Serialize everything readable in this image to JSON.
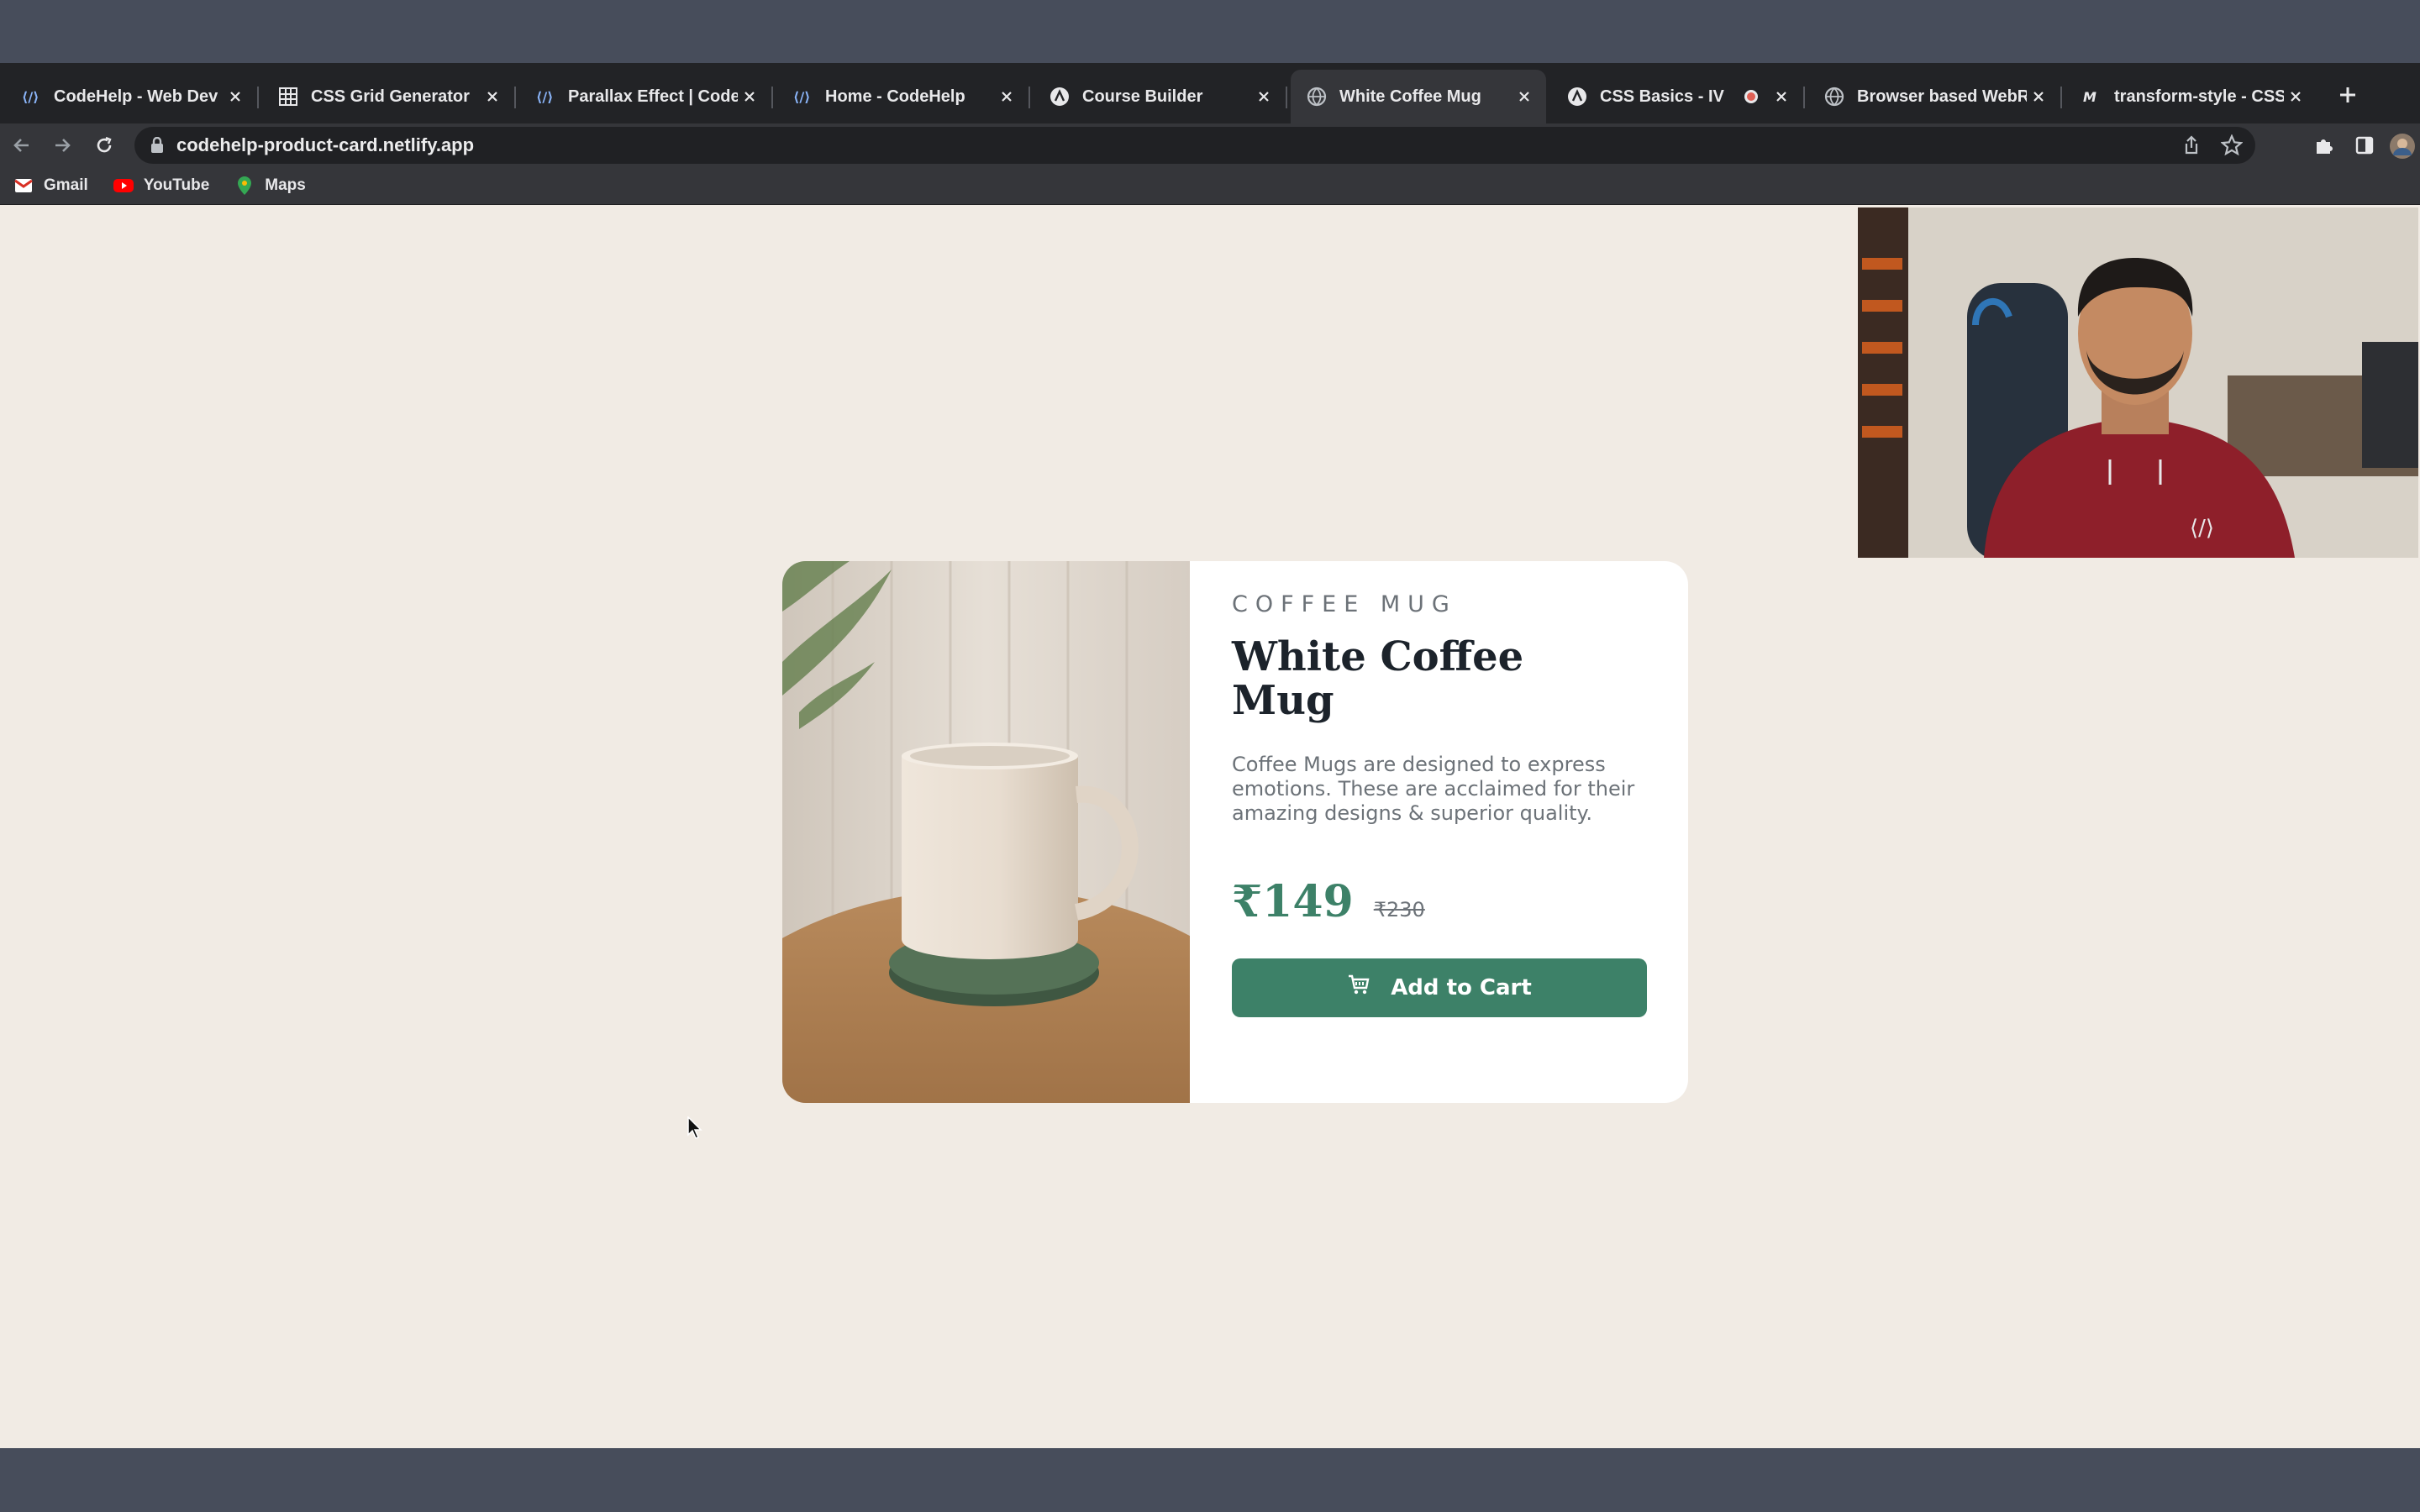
{
  "browser": {
    "tabs": [
      {
        "label": "CodeHelp - Web Dev",
        "icon": "codehelp-icon",
        "active": false
      },
      {
        "label": "CSS Grid Generator",
        "icon": "grid-icon",
        "active": false
      },
      {
        "label": "Parallax Effect | CodeHe",
        "icon": "codehelp-icon",
        "active": false
      },
      {
        "label": "Home - CodeHelp",
        "icon": "codehelp-icon",
        "active": false
      },
      {
        "label": "Course Builder",
        "icon": "course-builder-icon",
        "active": false
      },
      {
        "label": "White Coffee Mug",
        "icon": "globe-icon",
        "active": true
      },
      {
        "label": "CSS Basics - IV",
        "icon": "course-builder-icon",
        "active": false
      },
      {
        "label": "",
        "icon": "recording-icon",
        "active": false
      },
      {
        "label": "Browser based WebRTC",
        "icon": "globe-icon",
        "active": false
      },
      {
        "label": "transform-style - CSS: C",
        "icon": "mdn-icon",
        "active": false
      }
    ],
    "url": "codehelp-product-card.netlify.app",
    "bookmarks": [
      {
        "label": "Gmail",
        "icon": "gmail-icon"
      },
      {
        "label": "YouTube",
        "icon": "youtube-icon"
      },
      {
        "label": "Maps",
        "icon": "maps-icon"
      }
    ]
  },
  "product": {
    "category": "COFFEE MUG",
    "title": "White Coffee Mug",
    "description": "Coffee Mugs are designed to express emotions. These are acclaimed for their amazing designs & superior quality.",
    "price_current": "₹149",
    "price_original": "₹230",
    "add_to_cart_label": "Add to Cart"
  },
  "colors": {
    "accent": "#3d8168",
    "page_background": "#f1ebe4",
    "card_background": "#ffffff",
    "title_text": "#1c232b",
    "muted_text": "#6c7278"
  }
}
